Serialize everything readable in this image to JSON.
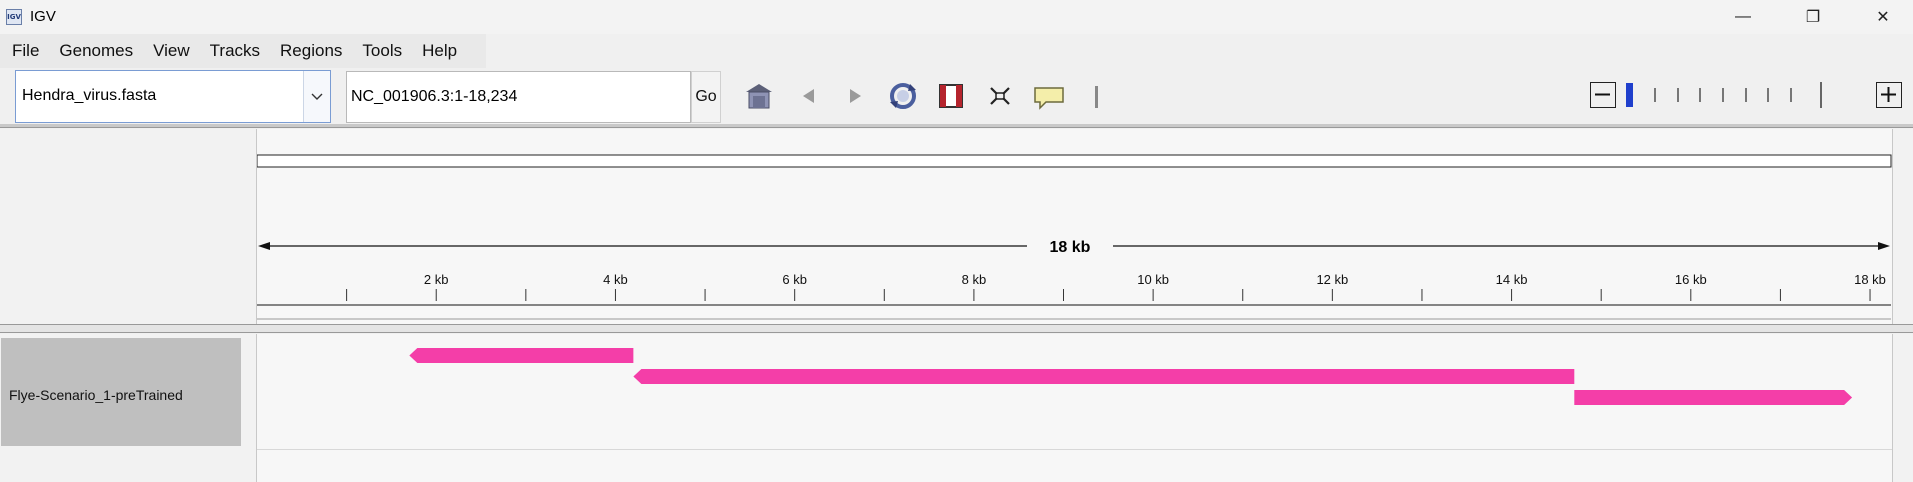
{
  "window": {
    "app_icon_label": "IGV",
    "title": "IGV",
    "minimize": "—",
    "restore": "❐",
    "close": "✕"
  },
  "menu": [
    "File",
    "Genomes",
    "View",
    "Tracks",
    "Regions",
    "Tools",
    "Help"
  ],
  "toolbar": {
    "genome": "Hendra_virus.fasta",
    "locus": "NC_001906.3:1-18,234",
    "go_label": "Go",
    "icons": [
      "home-icon",
      "back-icon",
      "forward-icon",
      "refresh-icon",
      "roi-icon",
      "fit-icon",
      "popup-info-icon",
      "divider-icon"
    ],
    "zoom_level_fraction": 0.0
  },
  "ruler": {
    "span_label": "18 kb",
    "tick_labels": [
      "2 kb",
      "4 kb",
      "6 kb",
      "8 kb",
      "10 kb",
      "12 kb",
      "14 kb",
      "16 kb",
      "18 kb"
    ],
    "tick_values_kb": [
      2,
      4,
      6,
      8,
      10,
      12,
      14,
      16,
      18
    ],
    "total_bp": 18234
  },
  "tracks": [
    {
      "name": "Flye-Scenario_1-preTrained",
      "color": "#f43ea8",
      "features": [
        {
          "start": 1700,
          "end": 4200,
          "strand": "-"
        },
        {
          "start": 4200,
          "end": 14700,
          "strand": "-"
        },
        {
          "start": 14700,
          "end": 17800,
          "strand": "+"
        }
      ]
    }
  ],
  "colors": {
    "accent": "#1f3fcc",
    "feature": "#f43ea8"
  }
}
